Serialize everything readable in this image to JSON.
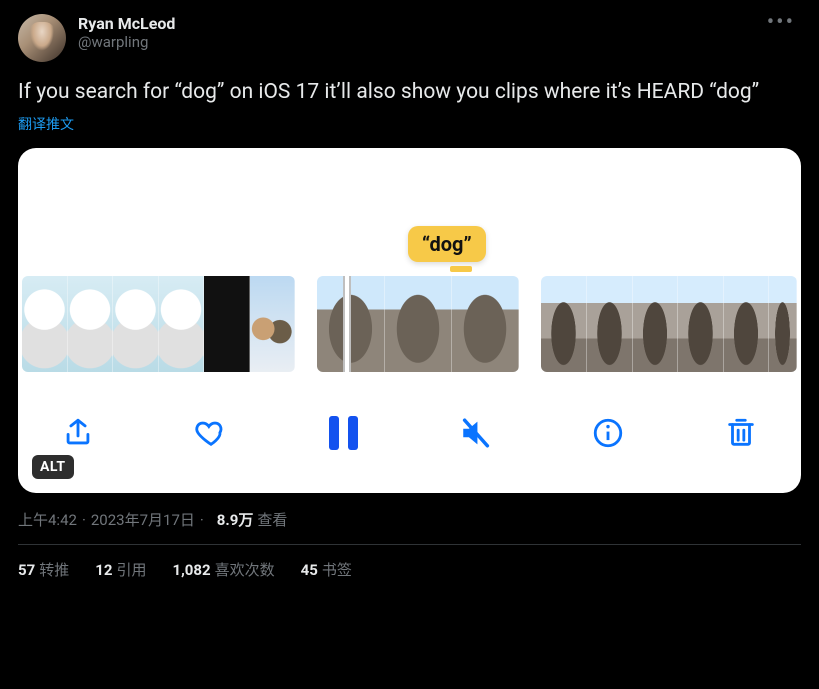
{
  "header": {
    "display_name": "Ryan McLeod",
    "handle": "@warpling"
  },
  "content": {
    "text": "If you search for “dog” on iOS 17 it’ll also show you clips where it’s HEARD “dog”",
    "translate_label": "翻译推文"
  },
  "media": {
    "bubble_text": "“dog”",
    "alt_badge": "ALT",
    "toolbar_icons": {
      "share": "share-icon",
      "like": "heart-icon",
      "pause": "pause-icon",
      "mute": "mute-icon",
      "info": "info-icon",
      "trash": "trash-icon"
    }
  },
  "meta": {
    "time": "上午4:42",
    "date": "2023年7月17日",
    "view_count": "8.9万",
    "view_label": "查看"
  },
  "stats": {
    "retweets": {
      "count": "57",
      "label": "转推"
    },
    "quotes": {
      "count": "12",
      "label": "引用"
    },
    "likes": {
      "count": "1,082",
      "label": "喜欢次数"
    },
    "bookmarks": {
      "count": "45",
      "label": "书签"
    }
  }
}
